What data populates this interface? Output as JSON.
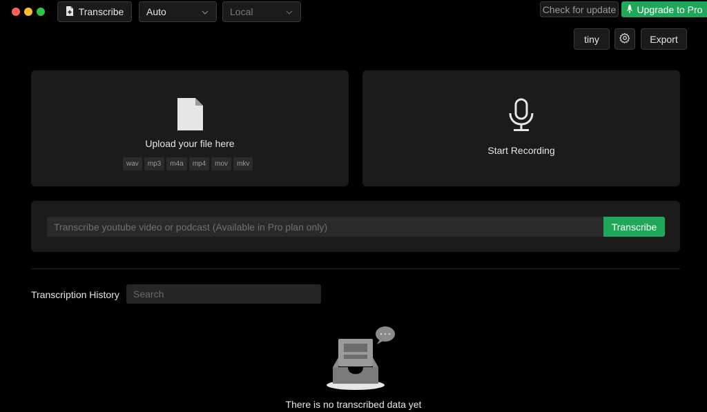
{
  "window": {
    "controls": [
      "close",
      "minimize",
      "zoom"
    ]
  },
  "toolbar": {
    "transcribe_label": "Transcribe",
    "language_select": "Auto",
    "engine_select": "Local",
    "check_update_label": "Check for update",
    "upgrade_label": "Upgrade to Pro",
    "model_label": "tiny",
    "export_label": "Export"
  },
  "upload": {
    "label": "Upload your file here",
    "formats": [
      "wav",
      "mp3",
      "m4a",
      "mp4",
      "mov",
      "mkv"
    ]
  },
  "record": {
    "label": "Start Recording"
  },
  "youtube": {
    "placeholder": "Transcribe youtube video or podcast (Available in Pro plan only)",
    "button_label": "Transcribe"
  },
  "history": {
    "title": "Transcription History",
    "search_placeholder": "Search",
    "empty_text": "There is no transcribed data yet"
  },
  "colors": {
    "accent": "#1fa85a",
    "card": "#1b1b1b",
    "background": "#000000"
  },
  "icons": [
    "file-plus-icon",
    "chevron-down-icon",
    "microphone-icon",
    "gear-icon",
    "file-icon",
    "empty-inbox-icon"
  ]
}
